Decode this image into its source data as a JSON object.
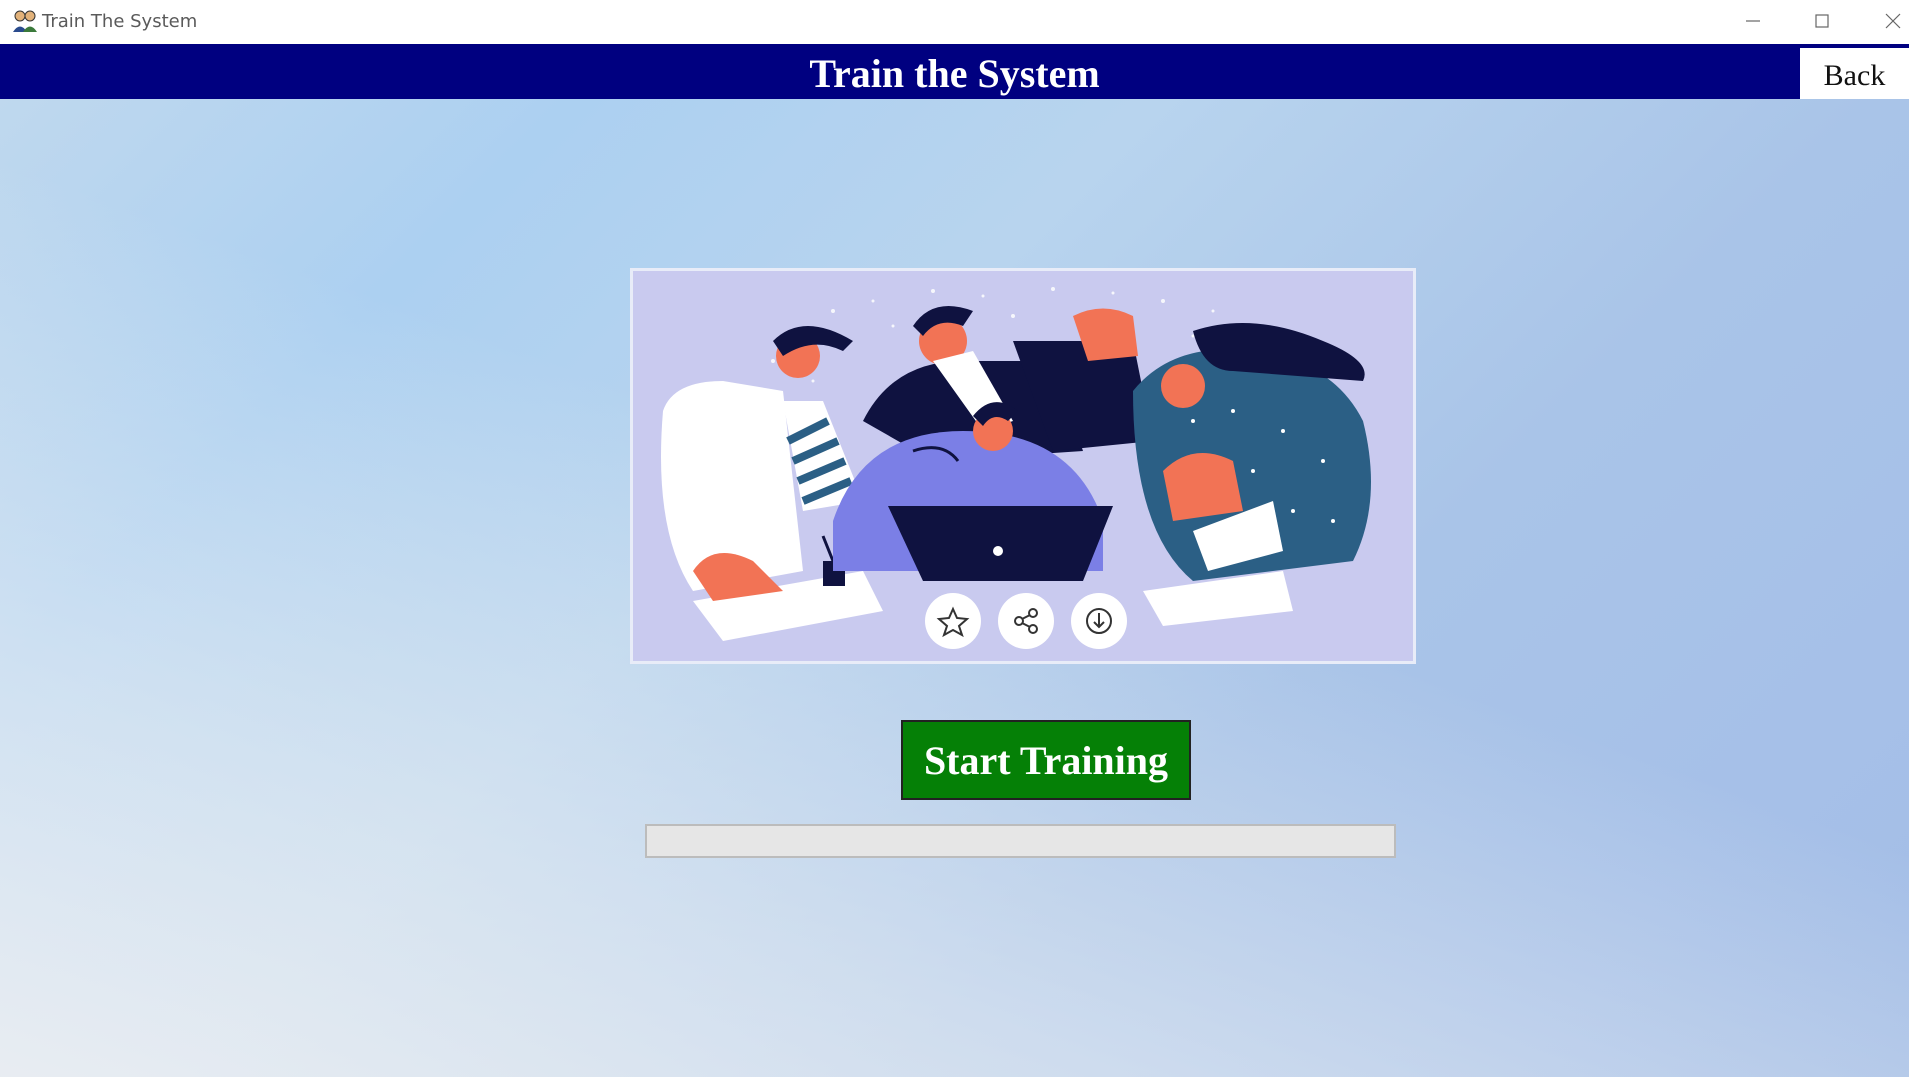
{
  "window": {
    "title": "Train The System",
    "app_icon": "people-icon",
    "controls": [
      "minimize-icon",
      "maximize-icon",
      "close-icon"
    ]
  },
  "header": {
    "title": "Train the System",
    "background": "#000080",
    "back_label": "Back"
  },
  "illustration": {
    "description_icon": "team-illustration",
    "overlay_icons": [
      "star-icon",
      "share-icon",
      "download-icon"
    ]
  },
  "actions": {
    "start_label": "Start Training",
    "start_color": "#058006"
  },
  "progress": {
    "value": 0
  }
}
